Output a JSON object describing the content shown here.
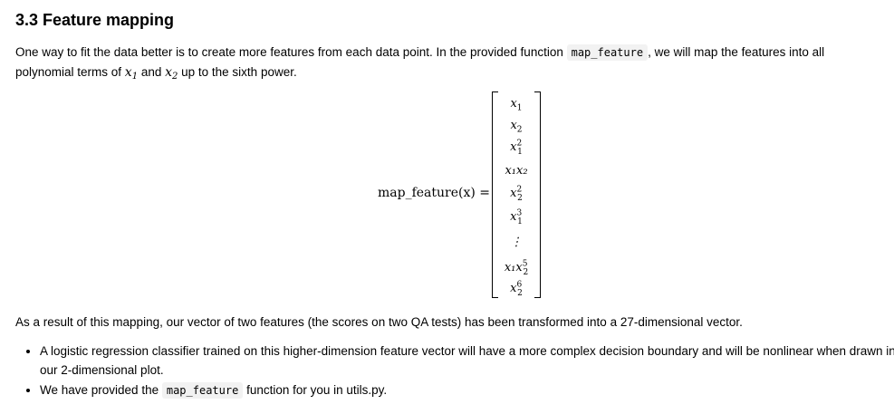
{
  "section": {
    "heading": "3.3 Feature mapping"
  },
  "intro": {
    "text_a": "One way to fit the data better is to create more features from each data point. In the provided function ",
    "code_a": "map_feature",
    "text_b": ", we will map the features into all polynomial terms of ",
    "var_x": "x",
    "sub_1": "1",
    "text_c": " and ",
    "sub_2": "2",
    "text_d": " up to the sixth power."
  },
  "equation": {
    "lhs": "map_feature(x) =",
    "vector": [
      {
        "base": "x",
        "sub": "1",
        "sup": ""
      },
      {
        "base": "x",
        "sub": "2",
        "sup": ""
      },
      {
        "base": "x",
        "sub": "1",
        "sup": "2"
      },
      {
        "base": "x₁x₂",
        "sub": "",
        "sup": ""
      },
      {
        "base": "x",
        "sub": "2",
        "sup": "2"
      },
      {
        "base": "x",
        "sub": "1",
        "sup": "3"
      },
      {
        "base": "⋮",
        "sub": "",
        "sup": ""
      },
      {
        "base": "x₁x",
        "sub": "2",
        "sup": "5"
      },
      {
        "base": "x",
        "sub": "2",
        "sup": "6"
      }
    ]
  },
  "result": {
    "text": "As a result of this mapping, our vector of two features (the scores on two QA tests) has been transformed into a 27-dimensional vector."
  },
  "bullets": {
    "item1": "A logistic regression classifier trained on this higher-dimension feature vector will have a more complex decision boundary and will be nonlinear when drawn in our 2-dimensional plot.",
    "item2_a": "We have provided the ",
    "item2_code": "map_feature",
    "item2_b": " function for you in utils.py."
  }
}
